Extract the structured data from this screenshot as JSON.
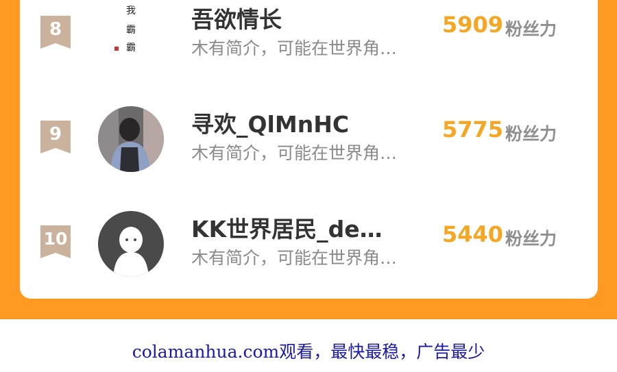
{
  "rows": [
    {
      "rank": "8",
      "name": "吾欲情长",
      "intro": "木有简介，可能在世界角…",
      "fans": "5909",
      "fans_label": "粉丝力",
      "avatar": "calligraphy-avatar"
    },
    {
      "rank": "9",
      "name": "寻欢_QlMnHC",
      "intro": "木有简介，可能在世界角…",
      "fans": "5775",
      "fans_label": "粉丝力",
      "avatar": "photo-avatar"
    },
    {
      "rank": "10",
      "name": "KK世界居民_de…",
      "intro": "木有简介，可能在世界角…",
      "fans": "5440",
      "fans_label": "粉丝力",
      "avatar": "default-avatar"
    }
  ],
  "avatar_calligraphy": [
    "我",
    "霸",
    "霸"
  ],
  "footer_text": "colamanhua.com观看，最快最稳，广告最少",
  "colors": {
    "accent": "#FE9A22",
    "fans": "#F5A623",
    "rank_badge": "#CBB29C",
    "footer_link": "#1a1aa8"
  }
}
